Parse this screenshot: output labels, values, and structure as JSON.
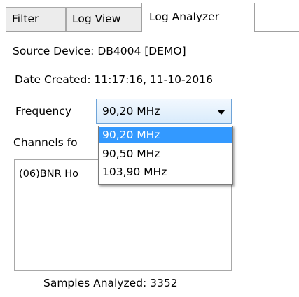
{
  "tabs": [
    {
      "label": "Filter"
    },
    {
      "label": "Log View"
    },
    {
      "label": "Log Analyzer",
      "active": true
    }
  ],
  "source_device": "Source Device:  DB4004 [DEMO]",
  "date_created": "Date Created:  11:17:16, 11-10-2016",
  "frequency": {
    "label": "Frequency",
    "selected": "90,20 MHz",
    "options": [
      "90,20 MHz",
      "90,50 MHz",
      "103,90 MHz"
    ]
  },
  "channels": {
    "label": "Channels fo",
    "items": [
      "(06)BNR Ho"
    ]
  },
  "samples_analyzed": "Samples Analyzed:  3352",
  "colors": {
    "selection": "#3399ff",
    "combo_border": "#6ea4d8"
  }
}
